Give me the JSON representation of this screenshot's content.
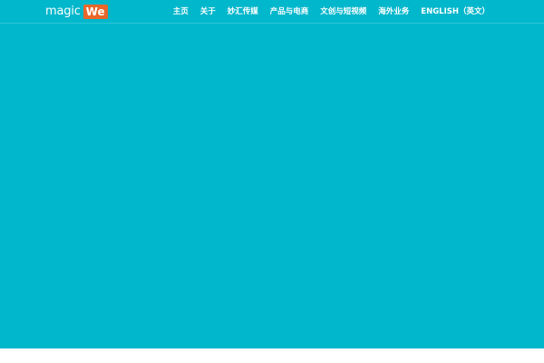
{
  "header": {
    "logo": {
      "text": "magic",
      "badge": "We"
    },
    "nav": [
      {
        "label": "主页"
      },
      {
        "label": "关于"
      },
      {
        "label": "妙汇传媒"
      },
      {
        "label": "产品与电商"
      },
      {
        "label": "文创与短视频"
      },
      {
        "label": "海外业务"
      },
      {
        "label": "ENGLISH（英文）"
      }
    ]
  },
  "colors": {
    "hero_background": "#00b7cc",
    "logo_badge": "#e8672a",
    "nav_text": "#ffffff"
  }
}
